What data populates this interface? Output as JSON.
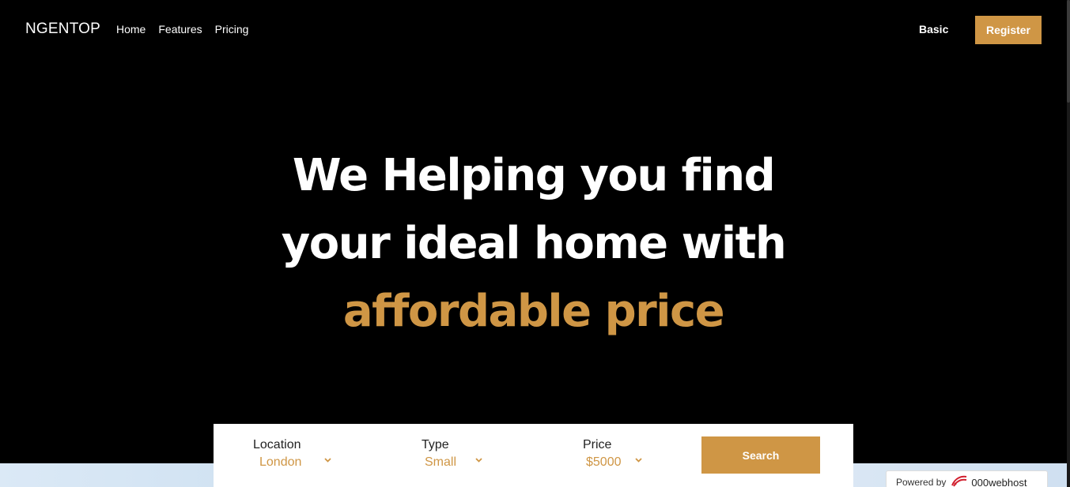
{
  "header": {
    "logo": "NGENTOP",
    "nav": [
      "Home",
      "Features",
      "Pricing"
    ],
    "basic_label": "Basic",
    "register_label": "Register"
  },
  "hero": {
    "line1": "We Helping you find",
    "line2": "your ideal home with",
    "line3": "affordable price"
  },
  "search": {
    "location": {
      "label": "Location",
      "value": "London"
    },
    "type": {
      "label": "Type",
      "value": "Small"
    },
    "price": {
      "label": "Price",
      "value": "$5000"
    },
    "button_label": "Search"
  },
  "powered_by": {
    "label": "Powered by",
    "brand": "000webhost",
    "icon": "000webhost-logo-icon"
  },
  "colors": {
    "accent": "#cf9645",
    "background": "#000000",
    "text": "#ffffff"
  }
}
